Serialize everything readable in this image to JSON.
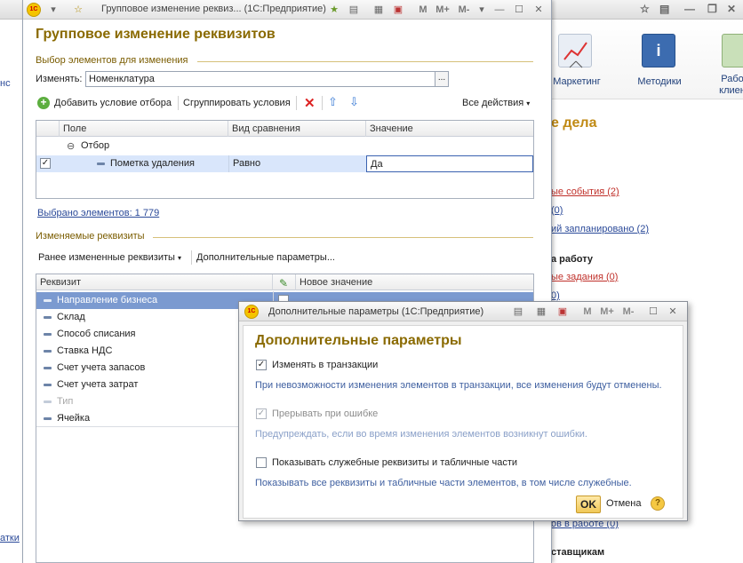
{
  "background_app": {
    "toolbar_items": [
      {
        "label": "Маркетинг",
        "icon": "chart-board-icon"
      },
      {
        "label": "Методики",
        "icon": "info-book-icon"
      },
      {
        "label": "Рабо клиен",
        "icon": "person-icon"
      }
    ],
    "left_fragments": [
      "нс",
      "атки"
    ],
    "section_title": "е дела",
    "links": [
      {
        "text": "ые события (2)",
        "style": "red"
      },
      {
        "text": "(0)",
        "style": "blue"
      },
      {
        "text": "ий запланировано (2)",
        "style": "blue"
      },
      {
        "text": "а работу",
        "style": "bold"
      },
      {
        "text": "ые задания (0)",
        "style": "red"
      },
      {
        "text": "0)",
        "style": "blue"
      },
      {
        "text": "ов в работе (0)",
        "style": "blue"
      },
      {
        "text": "ставщикам",
        "style": "bold"
      }
    ]
  },
  "main_dialog": {
    "title": "Групповое изменение реквиз... (1С:Предприятие)",
    "heading": "Групповое изменение реквизитов",
    "selection_group_caption": "Выбор элементов для изменения",
    "change_label": "Изменять:",
    "change_value": "Номенклатура",
    "change_button": "...",
    "filter_toolbar": {
      "add_condition": "Добавить условие отбора",
      "group_conditions": "Сгруппировать условия",
      "all_actions": "Все действия"
    },
    "filter_table": {
      "columns": [
        "Поле",
        "Вид сравнения",
        "Значение"
      ],
      "group_row": "Отбор",
      "rows": [
        {
          "checked": true,
          "field": "Пометка удаления",
          "comparison": "Равно",
          "value": "Да"
        }
      ]
    },
    "selected_count": "Выбрано элементов: 1 779",
    "attributes_group_caption": "Изменяемые реквизиты",
    "attr_toolbar": {
      "previous": "Ранее измененные реквизиты",
      "additional": "Дополнительные параметры..."
    },
    "attributes_table": {
      "columns": [
        "Реквизит",
        "Новое значение"
      ],
      "rows": [
        {
          "name": "Направление бизнеса",
          "state": "selected"
        },
        {
          "name": "Склад",
          "state": "normal"
        },
        {
          "name": "Способ списания",
          "state": "normal"
        },
        {
          "name": "Ставка НДС",
          "state": "normal"
        },
        {
          "name": "Счет учета запасов",
          "state": "normal"
        },
        {
          "name": "Счет учета затрат",
          "state": "normal"
        },
        {
          "name": "Тип",
          "state": "disabled"
        },
        {
          "name": "Ячейка",
          "state": "normal"
        }
      ]
    }
  },
  "popup": {
    "title": "Дополнительные параметры (1С:Предприятие)",
    "heading": "Дополнительные параметры",
    "options": [
      {
        "label": "Изменять в транзакции",
        "checked": true,
        "disabled": false,
        "description": "При невозможности изменения элементов в транзакции, все изменения будут отменены."
      },
      {
        "label": "Прерывать при ошибке",
        "checked": true,
        "disabled": true,
        "description": "Предупреждать, если во время изменения элементов возникнут ошибки."
      },
      {
        "label": "Показывать служебные реквизиты и табличные части",
        "checked": false,
        "disabled": false,
        "description": "Показывать все реквизиты и табличные части элементов, в том числе служебные."
      }
    ],
    "ok": "OK",
    "cancel": "Отмена",
    "help": "?"
  },
  "colors": {
    "heading": "#8a6a00",
    "link": "#2b4a99",
    "selection": "#7b9ad0",
    "row_highlight": "#d9e6fb",
    "ok_button": "#f0c858"
  }
}
